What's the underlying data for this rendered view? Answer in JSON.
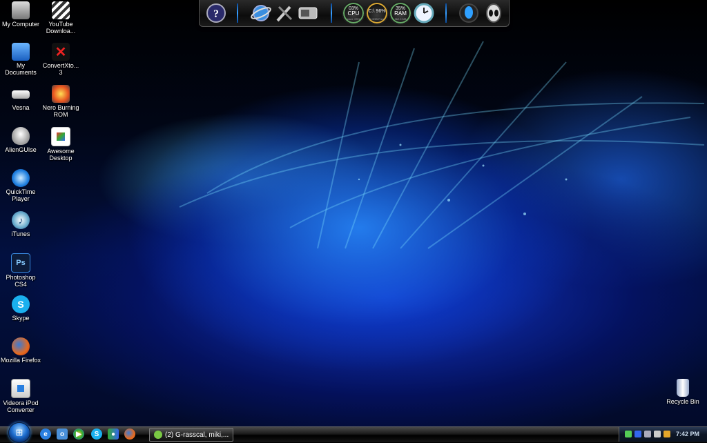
{
  "desktop": {
    "icons": [
      {
        "label": "My Computer",
        "icon": "computer-icon"
      },
      {
        "label": "YouTube Downloa...",
        "icon": "film-clapper-icon"
      },
      {
        "label": "My Documents",
        "icon": "documents-folder-icon"
      },
      {
        "label": "ConvertXto... 3",
        "icon": "convertx-icon"
      },
      {
        "label": "Vesna",
        "icon": "shortcut-icon"
      },
      {
        "label": "Nero Burning ROM",
        "icon": "nero-flame-icon"
      },
      {
        "label": "AlienGUIse",
        "icon": "alien-head-icon"
      },
      {
        "label": "Awesome Desktop",
        "icon": "picture-document-icon"
      },
      {
        "label": "QuickTime Player",
        "icon": "quicktime-icon"
      },
      {
        "label": "iTunes",
        "icon": "itunes-icon"
      },
      {
        "label": "Photoshop CS4",
        "icon": "photoshop-icon",
        "glyph": "Ps"
      },
      {
        "label": "Skype",
        "icon": "skype-icon",
        "glyph": "S"
      },
      {
        "label": "Mozilla Firefox",
        "icon": "firefox-icon"
      },
      {
        "label": "Videora iPod Converter",
        "icon": "ipod-converter-icon"
      },
      {
        "label": "Recycle Bin",
        "icon": "recycle-bin-icon"
      }
    ]
  },
  "dock": {
    "items": [
      "app-launcher-icon",
      "internet-explorer-icon",
      "tools-icon",
      "hard-drive-icon",
      "clock-icon",
      "alien-orb-icon",
      "alien-head-icon"
    ],
    "gauges": [
      {
        "name": "cpu-gauge",
        "top": "03%",
        "mid": "CPU",
        "bot": "User: 03%"
      },
      {
        "name": "disk-gauge",
        "top": "C:\\ 96%",
        "mid": "",
        "bot": "0.3GB Free"
      },
      {
        "name": "ram-gauge",
        "top": "35%",
        "mid": "RAM",
        "bot": "362.0 MB"
      }
    ]
  },
  "taskbar": {
    "start_icon": "windows-orb-icon",
    "quick_launch": [
      "internet-explorer-icon",
      "outlook-icon",
      "media-player-icon",
      "skype-icon",
      "messenger-icon",
      "firefox-icon"
    ],
    "task_button": "(2) G-rasscal, miki,...",
    "tray_icons": [
      "network-icon",
      "messenger-icon",
      "display-icon",
      "volume-icon",
      "security-icon",
      "warning-icon"
    ],
    "clock": "7:42 PM"
  },
  "colors": {
    "accent": "#1f6fd0",
    "wallpaper_glow": "#2a8cff"
  }
}
